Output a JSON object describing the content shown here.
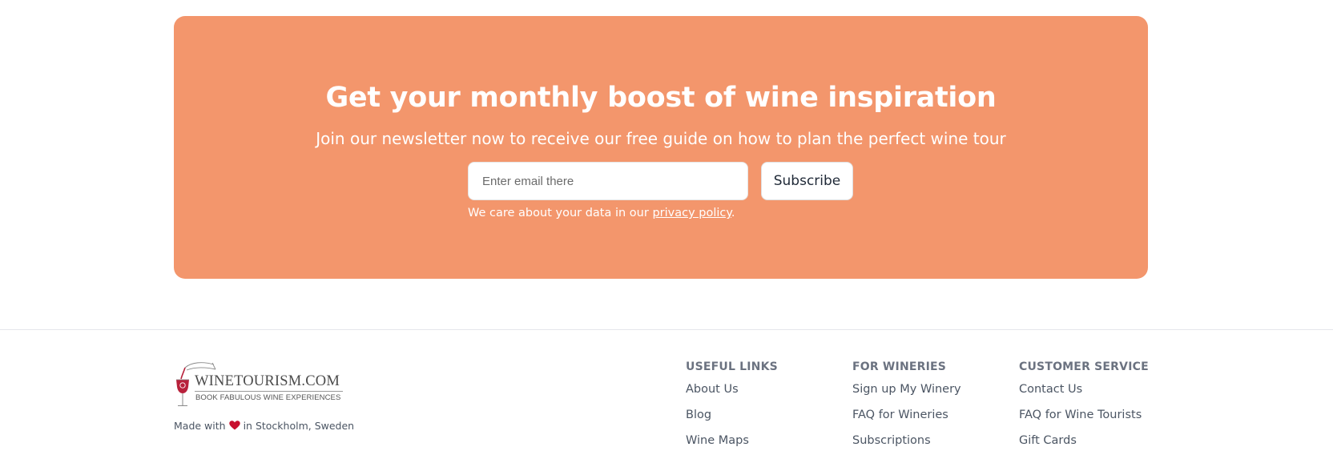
{
  "newsletter": {
    "headline": "Get your monthly boost of wine inspiration",
    "subline": "Join our newsletter now to receive our free guide on how to plan the perfect wine tour",
    "email_placeholder": "Enter email there",
    "email_value": "",
    "subscribe_label": "Subscribe",
    "privacy_prefix": "We care about your data in our ",
    "privacy_link": "privacy policy",
    "privacy_suffix": ".",
    "background_color": "#f3966c"
  },
  "footer": {
    "logo": {
      "name": "WINETOURISM.COM",
      "tagline": "BOOK FABULOUS WINE EXPERIENCES",
      "icon": "wine-glass-icon"
    },
    "made_with_prefix": "Made with",
    "made_with_suffix": "in Stockholm, Sweden",
    "heart_color": "#c8102e",
    "columns": [
      {
        "title": "USEFUL LINKS",
        "links": [
          "About Us",
          "Blog",
          "Wine Maps"
        ]
      },
      {
        "title": "FOR WINERIES",
        "links": [
          "Sign up My Winery",
          "FAQ for Wineries",
          "Subscriptions"
        ]
      },
      {
        "title": "CUSTOMER SERVICE",
        "links": [
          "Contact Us",
          "FAQ for Wine Tourists",
          "Gift Cards"
        ]
      }
    ]
  }
}
